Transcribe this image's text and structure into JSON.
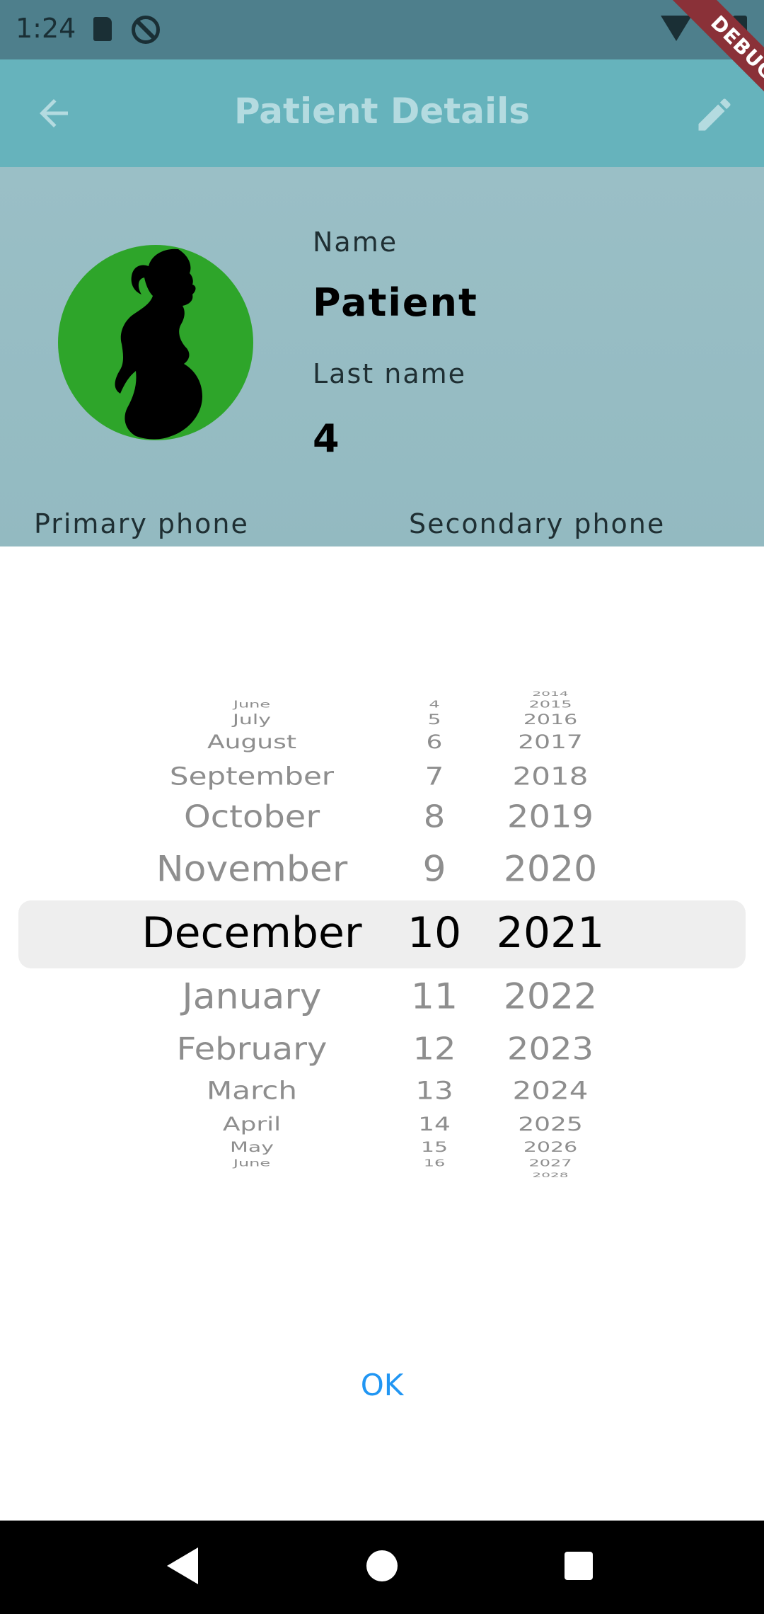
{
  "status_bar": {
    "time": "1:24",
    "debug_label": "DEBUG"
  },
  "app_bar": {
    "title": "Patient Details"
  },
  "patient": {
    "name_label": "Name",
    "name_value": "Patient",
    "lastname_label": "Last name",
    "lastname_value": "4",
    "primary_phone_label": "Primary phone",
    "secondary_phone_label": "Secondary phone"
  },
  "date_picker": {
    "months": {
      "above": [
        "June",
        "July",
        "August",
        "September",
        "October",
        "November"
      ],
      "selected": "December",
      "below": [
        "January",
        "February",
        "March",
        "April",
        "May",
        "June"
      ]
    },
    "days": {
      "above": [
        "4",
        "5",
        "6",
        "7",
        "8",
        "9"
      ],
      "selected": "10",
      "below": [
        "11",
        "12",
        "13",
        "14",
        "15",
        "16"
      ]
    },
    "years": {
      "above": [
        "2014",
        "2015",
        "2016",
        "2017",
        "2018",
        "2019",
        "2020"
      ],
      "selected": "2021",
      "below": [
        "2022",
        "2023",
        "2024",
        "2025",
        "2026",
        "2027",
        "2028"
      ]
    }
  },
  "dialog": {
    "ok_label": "OK"
  },
  "colors": {
    "app_bar": "#66b3bc",
    "patient_area": "#9abfc6",
    "avatar": "#2ea52a",
    "ok_accent": "#2196f3",
    "debug_banner": "#8a3138"
  }
}
